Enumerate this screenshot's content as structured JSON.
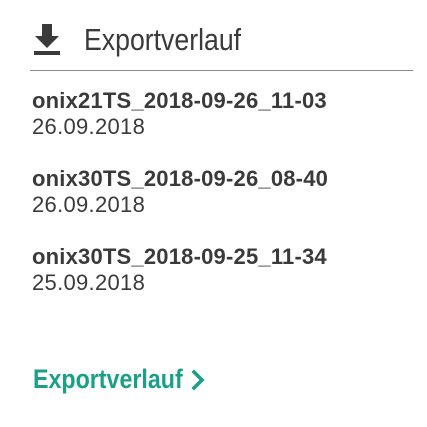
{
  "header": {
    "title": "Exportverlauf",
    "icon": "download-icon"
  },
  "export_history": {
    "items": [
      {
        "name": "onix21TS_2018-09-26_11-03",
        "date": "26.09.2018"
      },
      {
        "name": "onix30TS_2018-09-26_08-40",
        "date": "26.09.2018"
      },
      {
        "name": "onix30TS_2018-09-25_11-34",
        "date": "25.09.2018"
      }
    ]
  },
  "footer": {
    "link_label": "Exportverlauf",
    "link_icon": "chevron-right-icon"
  },
  "colors": {
    "text": "#3a3a3a",
    "accent": "#1aa088",
    "divider": "#8a8a8a"
  }
}
